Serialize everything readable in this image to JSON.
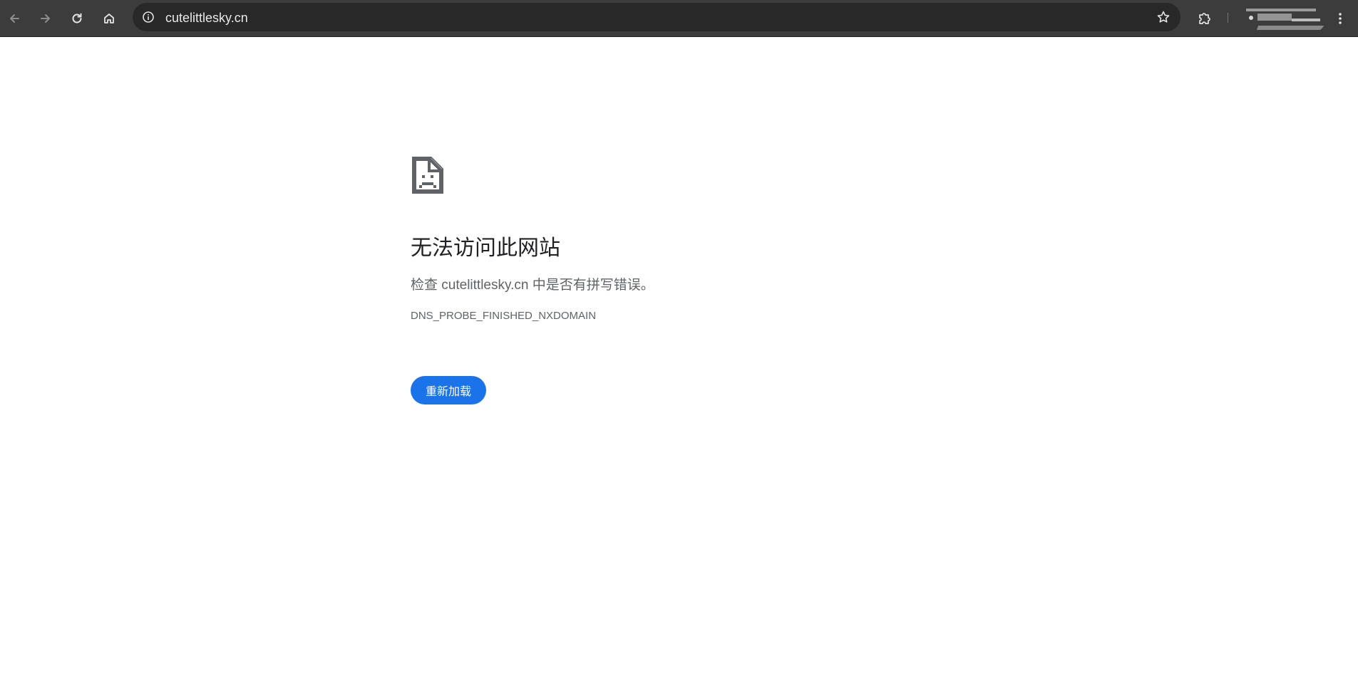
{
  "browser": {
    "url": "cutelittlesky.cn",
    "icons": {
      "back": "arrow-left-icon",
      "forward": "arrow-right-icon",
      "reload": "reload-icon",
      "home": "home-icon",
      "site_info": "info-icon",
      "bookmark": "star-icon",
      "extensions": "puzzle-icon",
      "menu": "more-vert-icon"
    },
    "colors": {
      "toolbar": "#3c3c3c",
      "omnibox": "#282828"
    }
  },
  "error_page": {
    "title": "无法访问此网站",
    "detail": "检查 cutelittlesky.cn 中是否有拼写错误。",
    "code": "DNS_PROBE_FINISHED_NXDOMAIN",
    "reload_label": "重新加载",
    "icon": "sad-document-icon",
    "colors": {
      "accent": "#1a73e8",
      "title": "#202124",
      "text": "#5f6368"
    }
  }
}
